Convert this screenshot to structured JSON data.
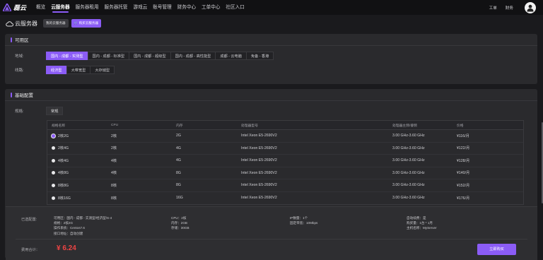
{
  "brand": {
    "name": "磊云"
  },
  "nav": {
    "items": [
      "概览",
      "云服务器",
      "服务器租用",
      "服务器托管",
      "游戏云",
      "账号管理",
      "财务中心",
      "工单中心",
      "社区入口"
    ],
    "active_index": 1
  },
  "top_right": {
    "links": [
      "工单",
      "财务"
    ]
  },
  "page": {
    "title": "云服务器",
    "btn_my": "我的云服务器",
    "btn_buy": "购买云服务器"
  },
  "region_panel": {
    "title": "可用区",
    "region_label": "地域:",
    "regions": [
      "国内 - 成都 - 实测型",
      "国内 - 成都 - 标准型",
      "国内 - 成都 - 超级型",
      "国内 - 成都 - 高性能型",
      "成都 - 云电脑",
      "免备 - 香港"
    ],
    "selected_region": 0,
    "line_label": "线路:",
    "lines": [
      "经济型",
      "大带宽型",
      "大存储型"
    ],
    "selected_line": 0
  },
  "config_panel": {
    "title": "基础配置",
    "spec_label": "规格:",
    "spec_tab": "常规",
    "columns": [
      "规格名称",
      "CPU",
      "内存",
      "处理器型号",
      "处理器主频/睿频",
      "价格"
    ],
    "rows": [
      {
        "name": "2核2G",
        "cpu": "2核",
        "mem": "2G",
        "proc": "Intel Xeon E5-2690V2",
        "freq": "3.00 GHz-3.60 GHz",
        "price": "¥116/月",
        "selected": true
      },
      {
        "name": "2核4G",
        "cpu": "2核",
        "mem": "4G",
        "proc": "Intel Xeon E5-2690V2",
        "freq": "3.00 GHz-3.60 GHz",
        "price": "¥122/月",
        "selected": false
      },
      {
        "name": "4核4G",
        "cpu": "4核",
        "mem": "4G",
        "proc": "Intel Xeon E5-2690V2",
        "freq": "3.00 GHz-3.60 GHz",
        "price": "¥128/月",
        "selected": false
      },
      {
        "name": "4核8G",
        "cpu": "4核",
        "mem": "8G",
        "proc": "Intel Xeon E5-2690V2",
        "freq": "3.00 GHz-3.60 GHz",
        "price": "¥140/月",
        "selected": false
      },
      {
        "name": "8核8G",
        "cpu": "8核",
        "mem": "8G",
        "proc": "Intel Xeon E5-2690V2",
        "freq": "3.00 GHz-3.60 GHz",
        "price": "¥152/月",
        "selected": false
      },
      {
        "name": "8核16G",
        "cpu": "8核",
        "mem": "16G",
        "proc": "Intel Xeon E5-2690V2",
        "freq": "3.00 GHz-3.60 GHz",
        "price": "¥176/月",
        "selected": false
      }
    ]
  },
  "summary": {
    "selected_label": "已选配置:",
    "col1": [
      "可用区：国内 - 成都 - 实测型/经济型/S-4",
      "规格：2核2G",
      "操作系统：Centos7.6",
      "接口地址：自动创建"
    ],
    "col2": [
      "CPU：2核",
      "内存：2GB",
      "存储：30GB"
    ],
    "col3": [
      "IP数量：1个",
      "固定带宽：10Mbps"
    ],
    "col4": [
      "自动续费：是",
      "购买量：1台 * 1月",
      "主机名称：MyServer"
    ],
    "fee_label": "费用合计：",
    "fee": "¥ 6.24",
    "buy_button": "立即购买"
  },
  "colors": {
    "accent": "#8b5cf6",
    "price": "#ef4444",
    "background": "#1a1a1d",
    "panel": "#2a2a2d"
  }
}
